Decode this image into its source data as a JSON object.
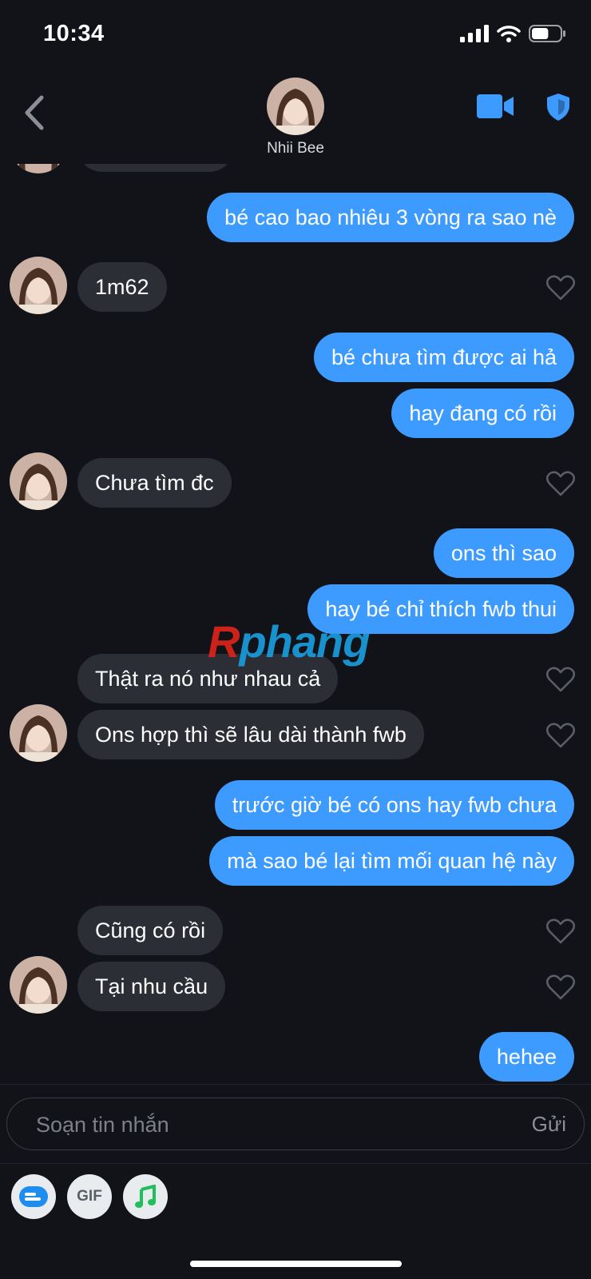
{
  "status_bar": {
    "time": "10:34",
    "battery_percent": 60
  },
  "header": {
    "contact_name": "Nhii Bee"
  },
  "messages": [
    {
      "from": "me",
      "text": "bé cao bao nhiêu 3 vòng ra sao nè"
    },
    {
      "from": "them",
      "text": "1m62"
    },
    {
      "from": "me",
      "text": "bé chưa tìm được ai hả"
    },
    {
      "from": "me",
      "text": "hay đang có rồi"
    },
    {
      "from": "them",
      "text": "Chưa tìm đc"
    },
    {
      "from": "me",
      "text": "ons thì sao"
    },
    {
      "from": "me",
      "text": "hay bé chỉ thích fwb thui"
    },
    {
      "from": "them",
      "text": "Thật ra nó như nhau cả"
    },
    {
      "from": "them",
      "text": "Ons hợp thì sẽ lâu dài thành fwb"
    },
    {
      "from": "me",
      "text": "trước giờ bé có ons hay fwb chưa"
    },
    {
      "from": "me",
      "text": "mà sao bé lại tìm mối quan hệ này"
    },
    {
      "from": "them",
      "text": "Cũng có rồi"
    },
    {
      "from": "them",
      "text": "Tại nhu cầu"
    },
    {
      "from": "me",
      "text": "hehee"
    }
  ],
  "watermark": {
    "first_letter": "R",
    "rest": "phang"
  },
  "composer": {
    "placeholder": "Soạn tin nhắn",
    "send_label": "Gửi"
  },
  "toolbar": {
    "gif_label": "GIF"
  },
  "colors": {
    "accent": "#3d9bff",
    "incoming_bubble": "#2b2e35",
    "background": "#111318"
  },
  "icons": [
    "back-chevron-icon",
    "video-call-icon",
    "shield-icon",
    "heart-icon",
    "sticker-icon",
    "music-icon"
  ]
}
